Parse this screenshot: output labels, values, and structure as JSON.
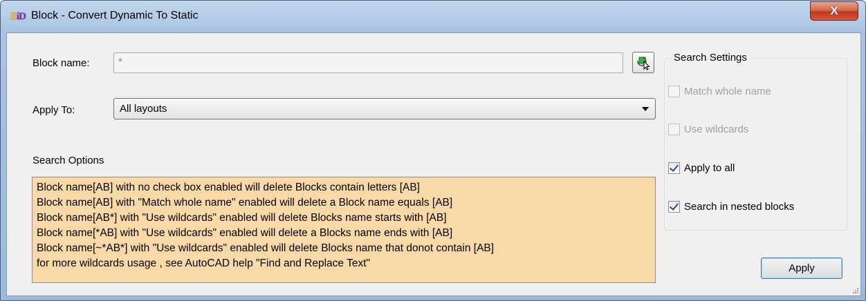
{
  "window": {
    "icon_text_left": "B",
    "icon_text_right": "iD",
    "title": "Block - Convert Dynamic To Static",
    "close_label": "X"
  },
  "form": {
    "block_name_label": "Block name:",
    "block_name_value": "*",
    "apply_to_label": "Apply To:",
    "apply_to_value": "All layouts",
    "search_options_label": "Search Options"
  },
  "search_options_text": [
    "Block name[AB] with no check box enabled will delete  Blocks contain letters [AB]",
    "Block name[AB] with \"Match whole name\" enabled will delete a Block name equals [AB]",
    "Block name[AB*] with \"Use wildcards\" enabled will delete  Blocks name starts with [AB]",
    "Block name[*AB] with \"Use wildcards\" enabled will delete a Blocks name ends with [AB]",
    "Block name[~*AB*] with \"Use wildcards\" enabled will delete Blocks name that donot contain [AB]",
    "for more wildcards usage , see AutoCAD help  \"Find and Replace Text\""
  ],
  "search_settings": {
    "title": "Search Settings",
    "options": [
      {
        "label": "Match whole name",
        "checked": false,
        "enabled": false
      },
      {
        "label": "Use wildcards",
        "checked": false,
        "enabled": false
      },
      {
        "label": "Apply to all",
        "checked": true,
        "enabled": true
      },
      {
        "label": "Search in nested blocks",
        "checked": true,
        "enabled": true
      }
    ]
  },
  "buttons": {
    "apply": "Apply"
  },
  "colors": {
    "info_background": "#fad9a8",
    "title_bar": "#a9c2e4",
    "close_button": "#c2391e"
  }
}
